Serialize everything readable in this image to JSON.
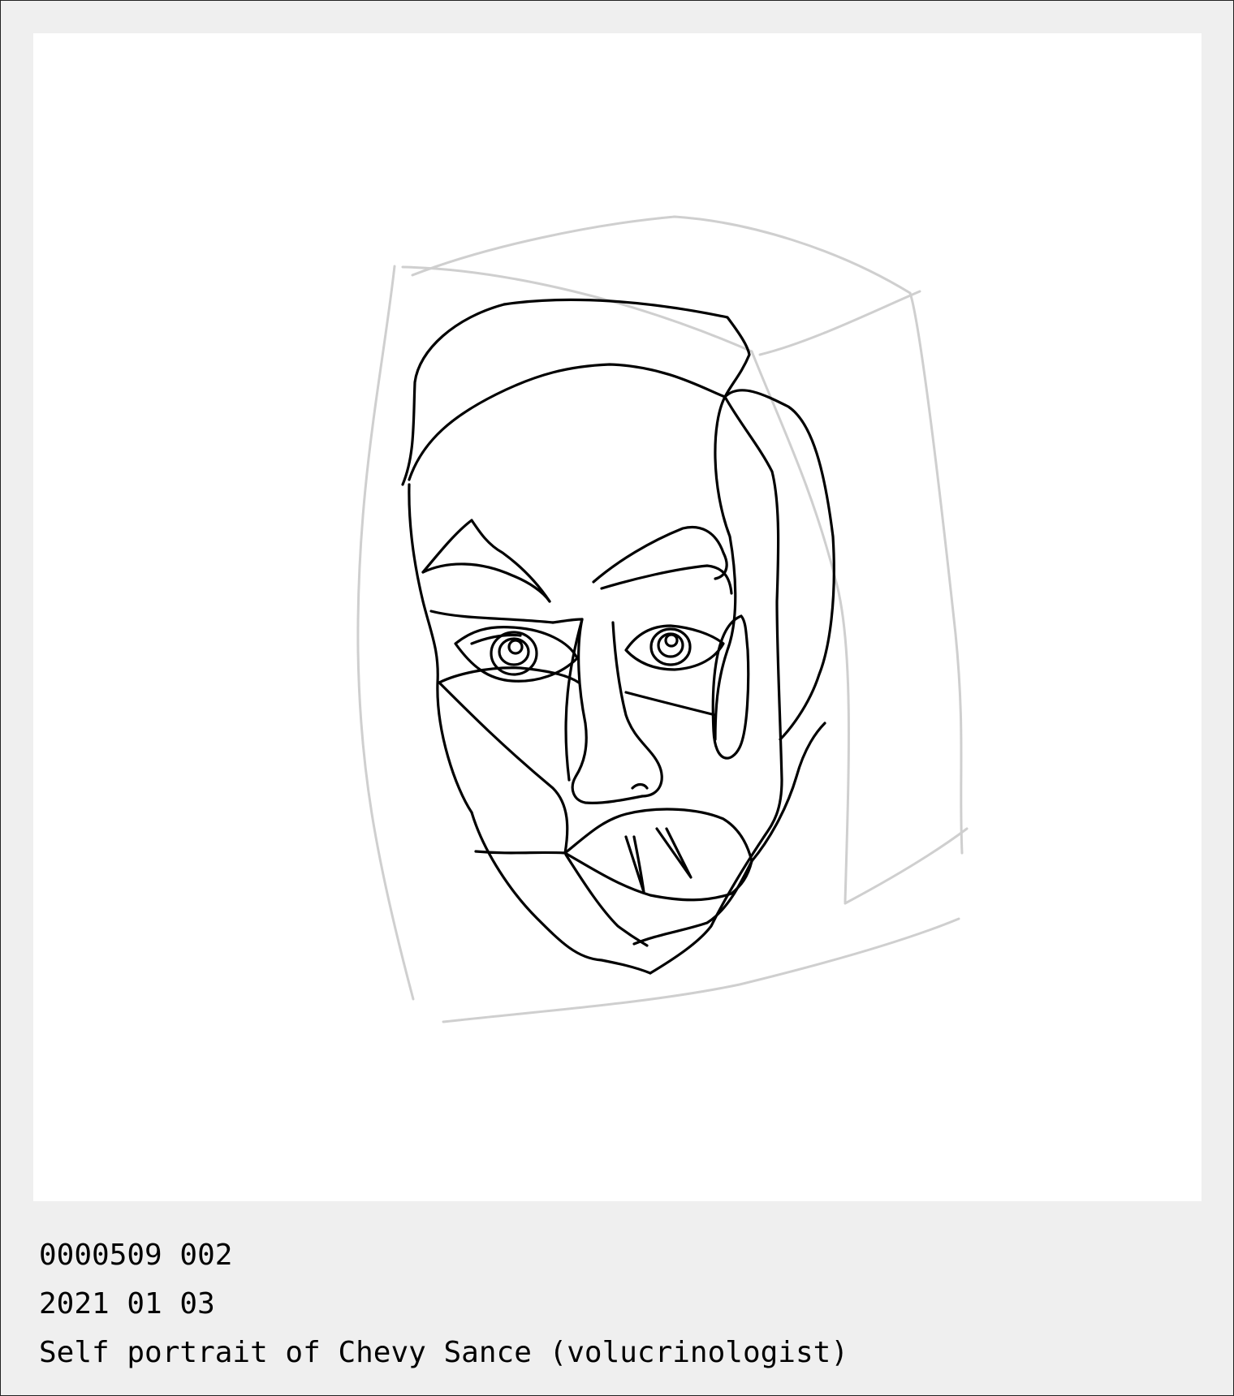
{
  "caption": {
    "id_line": "0000509 002",
    "date_line": "2021 01 03",
    "title_line": "Self portrait of Chevy Sance (volucrinologist)"
  },
  "drawing": {
    "subject": "line-drawing-face",
    "ink_color": "#000000",
    "guide_color": "#cfcfcf"
  },
  "colors": {
    "border": "#efefef",
    "canvas": "#ffffff"
  }
}
